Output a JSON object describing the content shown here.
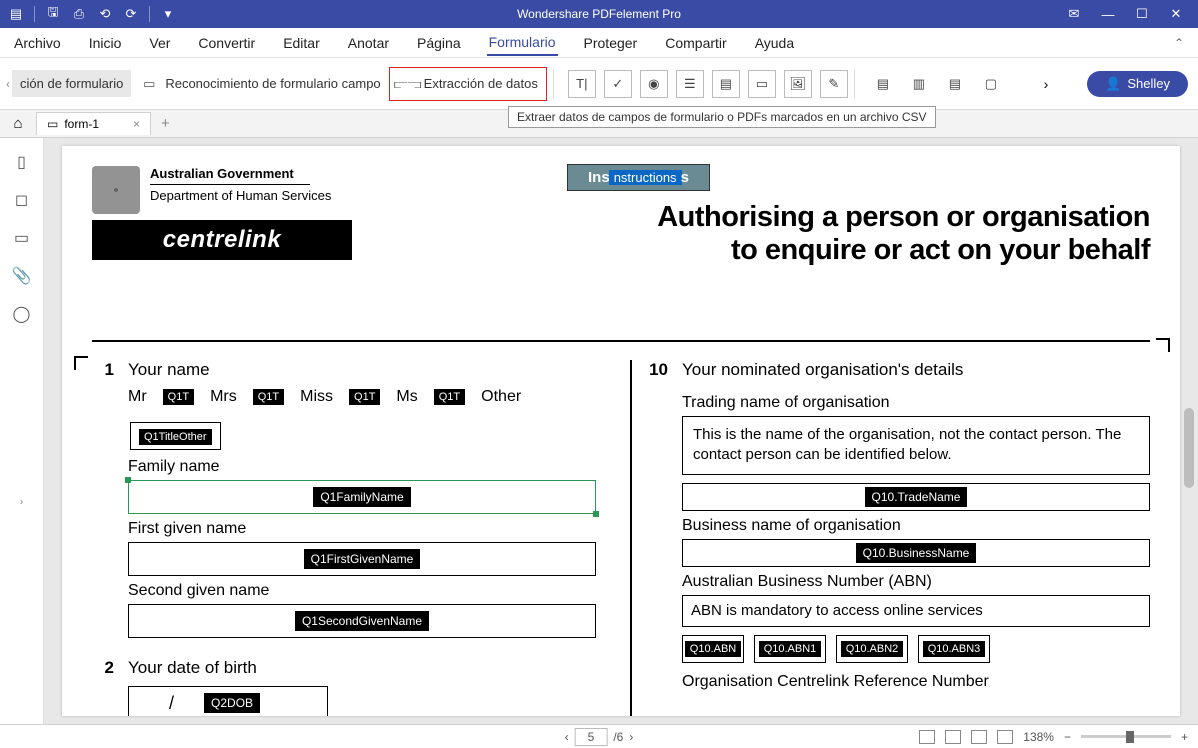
{
  "titlebar": {
    "app": "Wondershare PDFelement Pro"
  },
  "menu": {
    "items": [
      "Archivo",
      "Inicio",
      "Ver",
      "Convertir",
      "Editar",
      "Anotar",
      "Página",
      "Formulario",
      "Proteger",
      "Compartir",
      "Ayuda"
    ],
    "active": "Formulario"
  },
  "ribbon": {
    "btn_edit_cut": "ción de formulario",
    "btn_recognize": "Reconocimiento de formulario campo",
    "btn_extract": "Extracción de datos",
    "tooltip": "Extraer datos de campos de formulario o PDFs marcados en un archivo CSV",
    "user": "Shelley"
  },
  "tabs": {
    "doc": "form-1"
  },
  "doc": {
    "gov_l1": "Australian Government",
    "gov_l2": "Department of Human Services",
    "brand": "centrelink",
    "instructions_pre": "Ins",
    "instructions_hi": "nstructions",
    "instructions_post": "s",
    "title_l1": "Authorising a person or organisation",
    "title_l2": "to enquire or act on your behalf",
    "q1": {
      "num": "1",
      "title": "Your name",
      "opt_mr": "Mr",
      "opt_mrs": "Mrs",
      "opt_miss": "Miss",
      "opt_ms": "Ms",
      "opt_other": "Other",
      "cb": "Q1T",
      "title_other": "Q1TitleOther",
      "family_lbl": "Family name",
      "family_chip": "Q1FamilyName",
      "first_lbl": "First given name",
      "first_chip": "Q1FirstGivenName",
      "second_lbl": "Second given name",
      "second_chip": "Q1SecondGivenName"
    },
    "q2": {
      "num": "2",
      "title": "Your date of birth",
      "slash": "/",
      "chip": "Q2DOB"
    },
    "q10": {
      "num": "10",
      "title": "Your nominated organisation's details",
      "trade_lbl": "Trading name of organisation",
      "note": "This is the name of the organisation, not the contact person. The contact person can be identified below.",
      "trade_chip": "Q10.TradeName",
      "bus_lbl": "Business name of organisation",
      "bus_chip": "Q10.BusinessName",
      "abn_lbl": "Australian Business Number (ABN)",
      "abn_note": "ABN is mandatory to access online services",
      "abn0": "Q10.ABN",
      "abn1": "Q10.ABN1",
      "abn2": "Q10.ABN2",
      "abn3": "Q10.ABN3",
      "ref_lbl": "Organisation Centrelink Reference Number"
    }
  },
  "status": {
    "page_cur": "5",
    "page_tot": "/6",
    "zoom": "138%"
  }
}
